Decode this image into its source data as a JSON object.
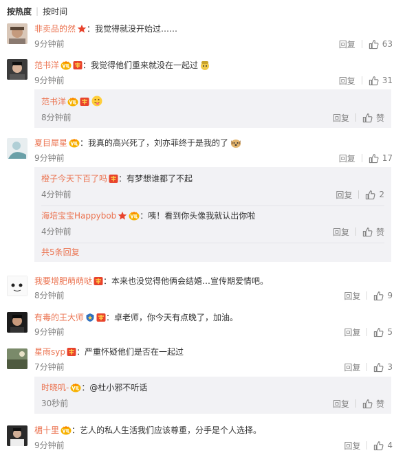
{
  "sortbar": {
    "hot": "按热度",
    "time": "按时间"
  },
  "actions": {
    "reply": "回复",
    "like": "赞"
  },
  "comments": [
    {
      "user": "非卖品的然",
      "text": "：我觉得就没开始过……",
      "time": "9分钟前",
      "likes": "63"
    },
    {
      "user": "范书洋",
      "text": "：我觉得他们重来就没在一起过",
      "time": "9分钟前",
      "likes": "31",
      "reply": {
        "user": "范书洋",
        "time": "8分钟前"
      }
    },
    {
      "user": "夏目犀星",
      "text": "：我真的高兴死了，刘亦菲终于是我的了",
      "time": "9分钟前",
      "likes": "17",
      "replies": [
        {
          "user": "橙子今天下百了吗",
          "text": "：有梦想谁都了不起",
          "time": "4分钟前",
          "likes": "2"
        },
        {
          "user": "海培宝宝Happybob",
          "text": "：咦！看到你头像我就认出你啦",
          "time": "4分钟前"
        }
      ],
      "more": "共5条回复"
    },
    {
      "user": "我要增肥萌萌哒",
      "text": "：本来也没觉得他俩会结婚…宣传期爱情吧。",
      "time": "8分钟前",
      "likes": "9"
    },
    {
      "user": "有毒的王大师",
      "text": "：卓老师，你今天有点晚了，加油。",
      "time": "9分钟前",
      "likes": "5"
    },
    {
      "user": "星雨syp",
      "text": "：严重怀疑他们是否在一起过",
      "time": "7分钟前",
      "likes": "3",
      "reply": {
        "user": "时晓叽-",
        "text": "：@杜小邪不听话",
        "time": "30秒前"
      }
    },
    {
      "user": "楣十里",
      "text": "：艺人的私人生活我们应该尊重，分手是个人选择。",
      "time": "9分钟前",
      "likes": "4"
    }
  ]
}
